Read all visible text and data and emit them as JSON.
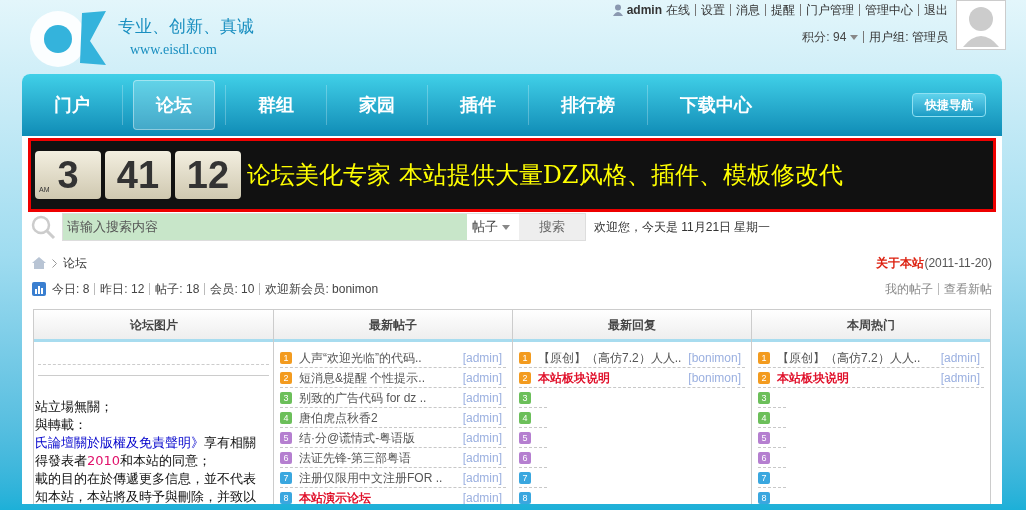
{
  "header": {
    "slogan": "专业、创新、真诚",
    "url": "www.eisdl.com",
    "user": "admin",
    "status": "在线",
    "links": [
      "设置",
      "消息",
      "提醒",
      "门户管理",
      "管理中心",
      "退出"
    ],
    "points": "积分: 94",
    "group": "用户组: 管理员"
  },
  "nav": {
    "items": [
      {
        "label": "门户",
        "selected": false
      },
      {
        "label": "论坛",
        "selected": true
      },
      {
        "label": "群组",
        "selected": false
      },
      {
        "label": "家园",
        "selected": false
      },
      {
        "label": "插件",
        "selected": false
      },
      {
        "label": "排行榜",
        "selected": false
      },
      {
        "label": "下载中心",
        "selected": false
      }
    ],
    "quick_nav": "快捷导航"
  },
  "marquee": {
    "clock": [
      "3",
      "41",
      "12"
    ],
    "ampm": "AM",
    "text": "论坛美化专家  本站提供大量DZ风格、插件、模板修改代"
  },
  "search": {
    "placeholder": "请输入搜索内容",
    "type": "帖子",
    "button": "搜索",
    "welcome": "欢迎您，今天是 11月21日  星期一"
  },
  "breadcrumb": {
    "current": "论坛",
    "about": "关于本站",
    "about_date": "(2011-11-20)"
  },
  "stats": {
    "items": [
      "今日: 8",
      "昨日: 12",
      "帖子: 18",
      "会员: 10",
      "欢迎新会员: bonimon"
    ],
    "links": [
      "我的帖子",
      "查看新帖"
    ]
  },
  "columns": [
    {
      "title": "论坛图片",
      "kind": "text",
      "lines": [
        {
          "kind": "plain",
          "text": "站立場無關；"
        },
        {
          "kind": "plain",
          "text": "與轉載："
        },
        {
          "kind": "link",
          "text": "氏論壇關於版權及免責聲明》",
          "rest": "享有相關"
        },
        {
          "kind": "num",
          "text": "得發表者",
          "num": "2010",
          "rest": "和本站的同意；"
        },
        {
          "kind": "plain",
          "text": "載的目的在於傳遞更多信息，並不代表"
        },
        {
          "kind": "plain",
          "text": "知本站，本站將及時予與刪除，并致以"
        }
      ]
    },
    {
      "title": "最新帖子",
      "kind": "list",
      "items": [
        {
          "rank": "1",
          "color": "#f39b1f",
          "title": "人声“欢迎光临”的代码..",
          "author": "[admin]",
          "hot": false
        },
        {
          "rank": "2",
          "color": "#f39b1f",
          "title": "短消息&提醒 个性提示..",
          "author": "[admin]",
          "hot": false
        },
        {
          "rank": "3",
          "color": "#6cbf5a",
          "title": "别致的广告代码 for dz ..",
          "author": "[admin]",
          "hot": false
        },
        {
          "rank": "4",
          "color": "#6cbf5a",
          "title": "唐伯虎点秋香2",
          "author": "[admin]",
          "hot": false
        },
        {
          "rank": "5",
          "color": "#b57fd0",
          "title": "结·分@谎情式-粤语版",
          "author": "[admin]",
          "hot": false
        },
        {
          "rank": "6",
          "color": "#b57fd0",
          "title": "法证先锋-第三部粤语",
          "author": "[admin]",
          "hot": false
        },
        {
          "rank": "7",
          "color": "#3aa7df",
          "title": "注册仅限用中文注册FOR ..",
          "author": "[admin]",
          "hot": false
        },
        {
          "rank": "8",
          "color": "#3aa7df",
          "title": "本站演示论坛",
          "author": "[admin]",
          "hot": true
        }
      ]
    },
    {
      "title": "最新回复",
      "kind": "list",
      "items": [
        {
          "rank": "1",
          "color": "#f39b1f",
          "title": "【原创】（高仿7.2）人人..",
          "author": "[bonimon]",
          "hot": false
        },
        {
          "rank": "2",
          "color": "#f39b1f",
          "title": "本站板块说明",
          "author": "[bonimon]",
          "hot": true
        },
        {
          "rank": "3",
          "color": "#6cbf5a"
        },
        {
          "rank": "4",
          "color": "#6cbf5a"
        },
        {
          "rank": "5",
          "color": "#b57fd0"
        },
        {
          "rank": "6",
          "color": "#b57fd0"
        },
        {
          "rank": "7",
          "color": "#3aa7df"
        },
        {
          "rank": "8",
          "color": "#3aa7df"
        }
      ]
    },
    {
      "title": "本周热门",
      "kind": "list",
      "items": [
        {
          "rank": "1",
          "color": "#f39b1f",
          "title": "【原创】（高仿7.2）人人..",
          "author": "[admin]",
          "hot": false
        },
        {
          "rank": "2",
          "color": "#f39b1f",
          "title": "本站板块说明",
          "author": "[admin]",
          "hot": true
        },
        {
          "rank": "3",
          "color": "#6cbf5a"
        },
        {
          "rank": "4",
          "color": "#6cbf5a"
        },
        {
          "rank": "5",
          "color": "#b57fd0"
        },
        {
          "rank": "6",
          "color": "#b57fd0"
        },
        {
          "rank": "7",
          "color": "#3aa7df"
        },
        {
          "rank": "8",
          "color": "#3aa7df"
        }
      ]
    }
  ]
}
